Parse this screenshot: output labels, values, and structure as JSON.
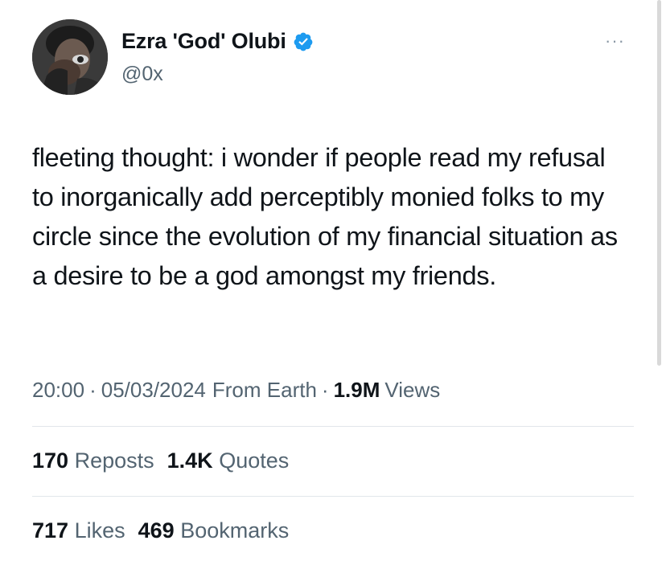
{
  "author": {
    "display_name": "Ezra 'God' Olubi",
    "handle": "@0x",
    "verified": true,
    "avatar_icon": "profile-photo-avatar"
  },
  "tweet": {
    "text": "fleeting thought: i wonder if people read my refusal to inorganically add perceptibly monied folks to my circle since the evolution of my financial situation as a desire to be a god amongst my friends."
  },
  "meta": {
    "time": "20:00",
    "date": "05/03/2024",
    "source": "From Earth",
    "separator": "·",
    "views_count": "1.9M",
    "views_label": "Views"
  },
  "stats": {
    "reposts_count": "170",
    "reposts_label": "Reposts",
    "quotes_count": "1.4K",
    "quotes_label": "Quotes",
    "likes_count": "717",
    "likes_label": "Likes",
    "bookmarks_count": "469",
    "bookmarks_label": "Bookmarks"
  },
  "more_menu": {
    "label": "···",
    "icon": "more-horizontal-icon"
  },
  "colors": {
    "text": "#0f1419",
    "secondary": "#536471",
    "verified": "#1d9bf0",
    "divider": "#e1e6ea"
  }
}
